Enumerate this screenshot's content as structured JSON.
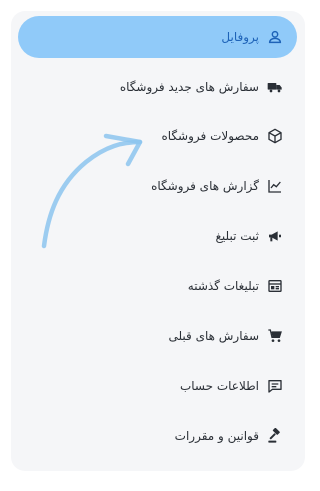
{
  "menu": {
    "items": [
      {
        "label": "پروفایل",
        "icon": "person-icon",
        "active": true
      },
      {
        "label": "سفارش های جدید فروشگاه",
        "icon": "truck-icon",
        "active": false
      },
      {
        "label": "محصولات فروشگاه",
        "icon": "box-icon",
        "active": false
      },
      {
        "label": "گزارش های فروشگاه",
        "icon": "trend-chart-icon",
        "active": false
      },
      {
        "label": "ثبت تبلیغ",
        "icon": "megaphone-icon",
        "active": false
      },
      {
        "label": "تبلیغات گذشته",
        "icon": "newspaper-icon",
        "active": false
      },
      {
        "label": "سفارش های قبلی",
        "icon": "cart-icon",
        "active": false
      },
      {
        "label": "اطلاعات حساب",
        "icon": "message-icon",
        "active": false
      },
      {
        "label": "قوانین و مقررات",
        "icon": "gavel-icon",
        "active": false
      }
    ]
  },
  "colors": {
    "active_bg": "#90caf9",
    "active_text": "#1e63b8",
    "text": "#2a2f36",
    "panel_bg": "#f5f6f8",
    "arrow": "#8cc4ee"
  }
}
